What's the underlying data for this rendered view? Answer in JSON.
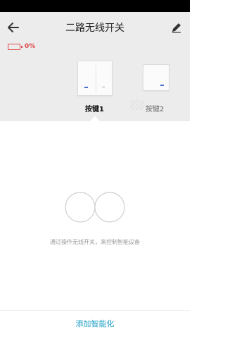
{
  "header": {
    "title": "二路无线开关"
  },
  "device": {
    "battery_text": "0%"
  },
  "buttons": [
    {
      "label": "按键1",
      "selected": true
    },
    {
      "label": "按键2",
      "selected": false
    }
  ],
  "empty_state": {
    "message": "通过操作无线开关，来控制智能设备"
  },
  "footer": {
    "add_label": "添加智能化"
  },
  "colors": {
    "accent": "#1e9fc5",
    "battery": "#e04848",
    "led": "#4a6fd1"
  }
}
